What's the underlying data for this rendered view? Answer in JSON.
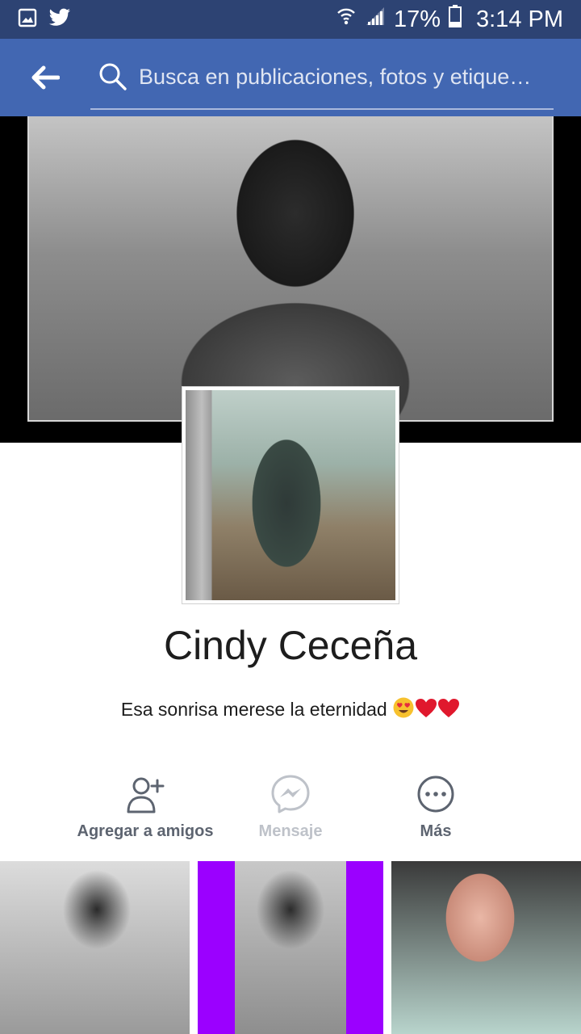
{
  "status_bar": {
    "notification_icons": [
      "gallery-icon",
      "twitter-icon"
    ],
    "battery_percent": "17%",
    "time": "3:14 PM"
  },
  "search": {
    "placeholder": "Busca en publicaciones, fotos y etique…"
  },
  "profile": {
    "name": "Cindy Ceceña",
    "bio": "Esa sonrisa merese la eternidad"
  },
  "actions": {
    "add_friend": "Agregar a amigos",
    "message": "Mensaje",
    "more": "Más"
  },
  "colors": {
    "status_bar": "#2d4373",
    "app_bar": "#4267b2",
    "action_active": "#5d6470",
    "action_disabled": "#bec2c9",
    "photo_border_accent": "#9b00ff"
  }
}
